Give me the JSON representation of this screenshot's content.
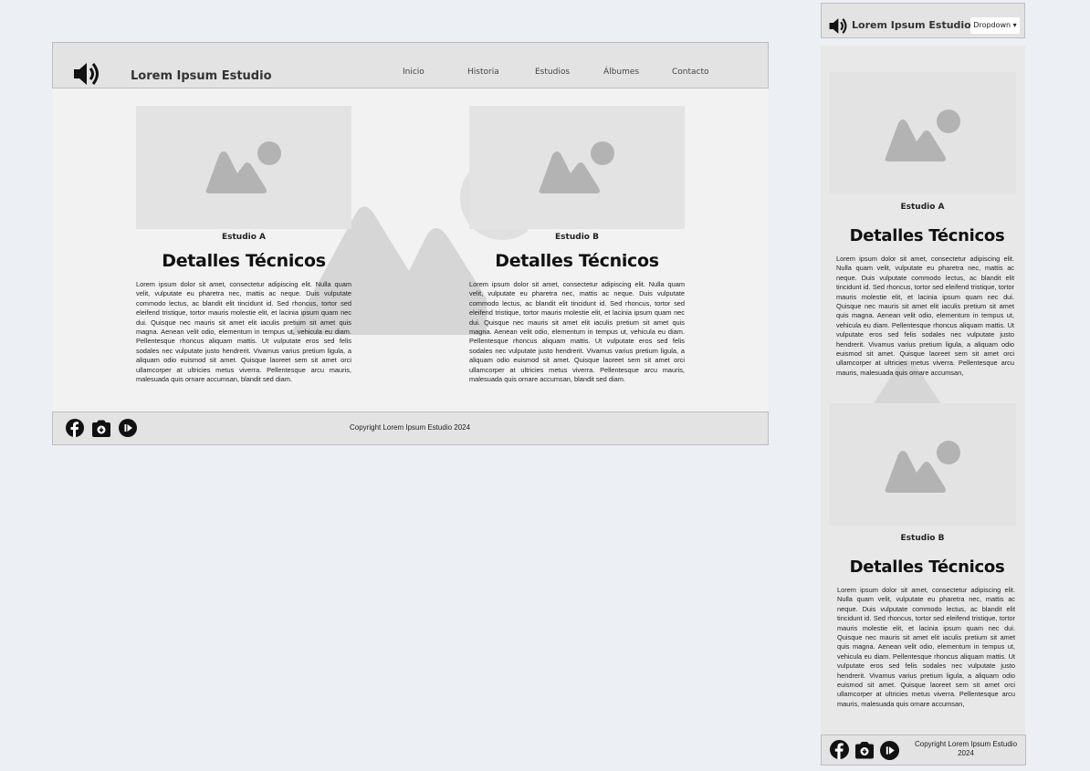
{
  "colors": {
    "page_bg": "#eceff3",
    "header_bg": "#e3e3e3",
    "body_bg": "#f2f2f2",
    "placeholder": "#e3e3e3",
    "placeholder_icon": "#b3b3b3"
  },
  "desktop": {
    "brand": "Lorem Ipsum Estudio",
    "logo_icon": "speaker-icon",
    "nav": [
      "Inicio",
      "Historia",
      "Estudios",
      "Álbumes",
      "Contacto"
    ],
    "cards": [
      {
        "caption": "Estudio A",
        "heading": "Detalles Técnicos",
        "image_icon": "image-placeholder-icon",
        "text": "Lorem ipsum dolor sit amet, consectetur adipiscing elit. Nulla quam velit, vulputate eu pharetra nec, mattis ac neque. Duis vulputate commodo lectus, ac blandit elit tincidunt id. Sed rhoncus, tortor sed eleifend tristique, tortor mauris molestie elit, et lacinia ipsum quam nec dui. Quisque nec mauris sit amet elit iaculis pretium sit amet quis magna. Aenean velit odio, elementum in tempus ut, vehicula eu diam. Pellentesque rhoncus aliquam mattis. Ut vulputate eros sed felis sodales nec vulputate justo hendrerit. Vivamus varius pretium ligula, a aliquam odio euismod sit amet. Quisque laoreet sem sit amet orci ullamcorper at ultricies metus viverra. Pellentesque arcu mauris, malesuada quis ornare accumsan, blandit sed diam."
      },
      {
        "caption": "Estudio B",
        "heading": "Detalles Técnicos",
        "image_icon": "image-placeholder-icon",
        "text": "Lorem ipsum dolor sit amet, consectetur adipiscing elit. Nulla quam velit, vulputate eu pharetra nec, mattis ac neque. Duis vulputate commodo lectus, ac blandit elit tincidunt id. Sed rhoncus, tortor sed eleifend tristique, tortor mauris molestie elit, et lacinia ipsum quam nec dui. Quisque nec mauris sit amet elit iaculis pretium sit amet quis magna. Aenean velit odio, elementum in tempus ut, vehicula eu diam. Pellentesque rhoncus aliquam mattis. Ut vulputate eros sed felis sodales nec vulputate justo hendrerit. Vivamus varius pretium ligula, a aliquam odio euismod sit amet. Quisque laoreet sem sit amet orci ullamcorper at ultricies metus viverra. Pellentesque arcu mauris, malesuada quis ornare accumsan, blandit sed diam."
      }
    ],
    "footer": {
      "copyright": "Copyright Lorem Ipsum Estudio 2024",
      "social_icons": [
        "facebook-icon",
        "camera-icon",
        "play-icon"
      ]
    }
  },
  "mobile": {
    "brand": "Lorem Ipsum Estudio",
    "dropdown_label": "Dropdown ▾",
    "cards": [
      {
        "caption": "Estudio A",
        "heading": "Detalles Técnicos",
        "text": "Lorem ipsum dolor sit amet, consectetur adipiscing elit. Nulla quam velit, vulputate eu pharetra nec, mattis ac neque. Duis vulputate commodo lectus, ac blandit elit tincidunt id. Sed rhoncus, tortor sed eleifend tristique, tortor mauris molestie elit, et lacinia ipsum quam nec dui. Quisque nec mauris sit amet elit iaculis pretium sit amet quis magna. Aenean velit odio, elementum in tempus ut, vehicula eu diam. Pellentesque rhoncus aliquam mattis. Ut vulputate eros sed felis sodales nec vulputate justo hendrerit. Vivamus varius pretium ligula, a aliquam odio euismod sit amet. Quisque laoreet sem sit amet orci ullamcorper at ultricies metus viverra. Pellentesque arcu mauris, malesuada quis ornare accumsan,"
      },
      {
        "caption": "Estudio B",
        "heading": "Detalles Técnicos",
        "text": "Lorem ipsum dolor sit amet, consectetur adipiscing elit. Nulla quam velit, vulputate eu pharetra nec, mattis ac neque. Duis vulputate commodo lectus, ac blandit elit tincidunt id. Sed rhoncus, tortor sed eleifend tristique, tortor mauris molestie elit, et lacinia ipsum quam nec dui. Quisque nec mauris sit amet elit iaculis pretium sit amet quis magna. Aenean velit odio, elementum in tempus ut, vehicula eu diam. Pellentesque rhoncus aliquam mattis. Ut vulputate eros sed felis sodales nec vulputate justo hendrerit. Vivamus varius pretium ligula, a aliquam odio euismod sit amet. Quisque laoreet sem sit amet orci ullamcorper at ultricies metus viverra. Pellentesque arcu mauris, malesuada quis ornare accumsan,"
      }
    ],
    "footer": {
      "copyright": "Copyright Lorem Ipsum Estudio 2024"
    }
  }
}
